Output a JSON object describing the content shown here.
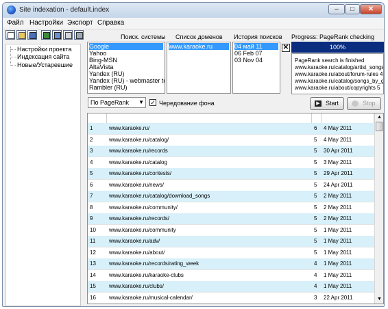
{
  "window": {
    "title": "Site indexation - default.index"
  },
  "window_buttons": {
    "minimize": "–",
    "maximize": "□",
    "close": "✕"
  },
  "menu": [
    "Файл",
    "Настройки",
    "Экспорт",
    "Справка"
  ],
  "toolbar": {
    "icons": [
      "new-icon",
      "open-icon",
      "save-icon",
      "export-icon",
      "report-icon",
      "properties-icon",
      "print-icon"
    ]
  },
  "tree": {
    "items": [
      "Настройки проекта",
      "Индексация сайта",
      "Новые/Устаревшие"
    ]
  },
  "search_systems": {
    "header": "Поиск. системы",
    "items": [
      "Google",
      "Yahoo",
      "Bing-MSN",
      "AltaVista",
      "Yandex (RU)",
      "Yandex (RU) - webmaster tools",
      "Rambler (RU)"
    ],
    "selected": "Google"
  },
  "domains": {
    "header": "Список доменов",
    "items": [
      "www.karaoke.ru"
    ],
    "selected": "www.karaoke.ru"
  },
  "history": {
    "header": "История поисков",
    "items": [
      "04 май 11",
      "06 Feb 07",
      "03 Nov 04"
    ],
    "selected": "04 май 11"
  },
  "progress": {
    "header": "Progress: PageRank checking",
    "value_label": "100%",
    "value": 1.0,
    "log": [
      "PageRank search is finished",
      "www.karaoke.ru/catalog/artist_songs.",
      "www.karaoke.ru/about/forum-rules 4",
      "www.karaoke.ru/catalog/songs_by_g",
      "www.karaoke.ru/about/copyrights 5"
    ]
  },
  "controls": {
    "sort_value": "По PageRank",
    "alt_background_label": "Чередование фона",
    "alt_background_checked": true,
    "start_label": "Start",
    "stop_label": "Stop"
  },
  "table": {
    "rows": [
      {
        "n": "1",
        "url": "www.karaoke.ru/",
        "pr": "6",
        "date": "4 May 2011"
      },
      {
        "n": "2",
        "url": "www.karaoke.ru/catalog/",
        "pr": "5",
        "date": "4 May 2011"
      },
      {
        "n": "3",
        "url": "www.karaoke.ru/records",
        "pr": "5",
        "date": "30 Apr 2011"
      },
      {
        "n": "4",
        "url": "www.karaoke.ru/catalog",
        "pr": "5",
        "date": "3 May 2011"
      },
      {
        "n": "5",
        "url": "www.karaoke.ru/contests/",
        "pr": "5",
        "date": "29 Apr 2011"
      },
      {
        "n": "6",
        "url": "www.karaoke.ru/news/",
        "pr": "5",
        "date": "24 Apr 2011"
      },
      {
        "n": "7",
        "url": "www.karaoke.ru/catalog/download_songs",
        "pr": "5",
        "date": "2 May 2011"
      },
      {
        "n": "8",
        "url": "www.karaoke.ru/community/",
        "pr": "5",
        "date": "2 May 2011"
      },
      {
        "n": "9",
        "url": "www.karaoke.ru/records/",
        "pr": "5",
        "date": "2 May 2011"
      },
      {
        "n": "10",
        "url": "www.karaoke.ru/community",
        "pr": "5",
        "date": "1 May 2011"
      },
      {
        "n": "11",
        "url": "www.karaoke.ru/adv/",
        "pr": "5",
        "date": "1 May 2011"
      },
      {
        "n": "12",
        "url": "www.karaoke.ru/about/",
        "pr": "5",
        "date": "1 May 2011"
      },
      {
        "n": "13",
        "url": "www.karaoke.ru/records/rating_week",
        "pr": "4",
        "date": "1 May 2011"
      },
      {
        "n": "14",
        "url": "www.karaoke.ru/karaoke-clubs",
        "pr": "4",
        "date": "1 May 2011"
      },
      {
        "n": "15",
        "url": "www.karaoke.ru/clubs/",
        "pr": "4",
        "date": "1 May 2011"
      },
      {
        "n": "16",
        "url": "www.karaoke.ru/musical-calendar/",
        "pr": "3",
        "date": "22 Apr 2011"
      }
    ]
  },
  "colors": {
    "row_alt": "#d7f0fa",
    "row_plain": "#ffffff",
    "selection": "#3399ff",
    "progress": "#0a2d80"
  }
}
